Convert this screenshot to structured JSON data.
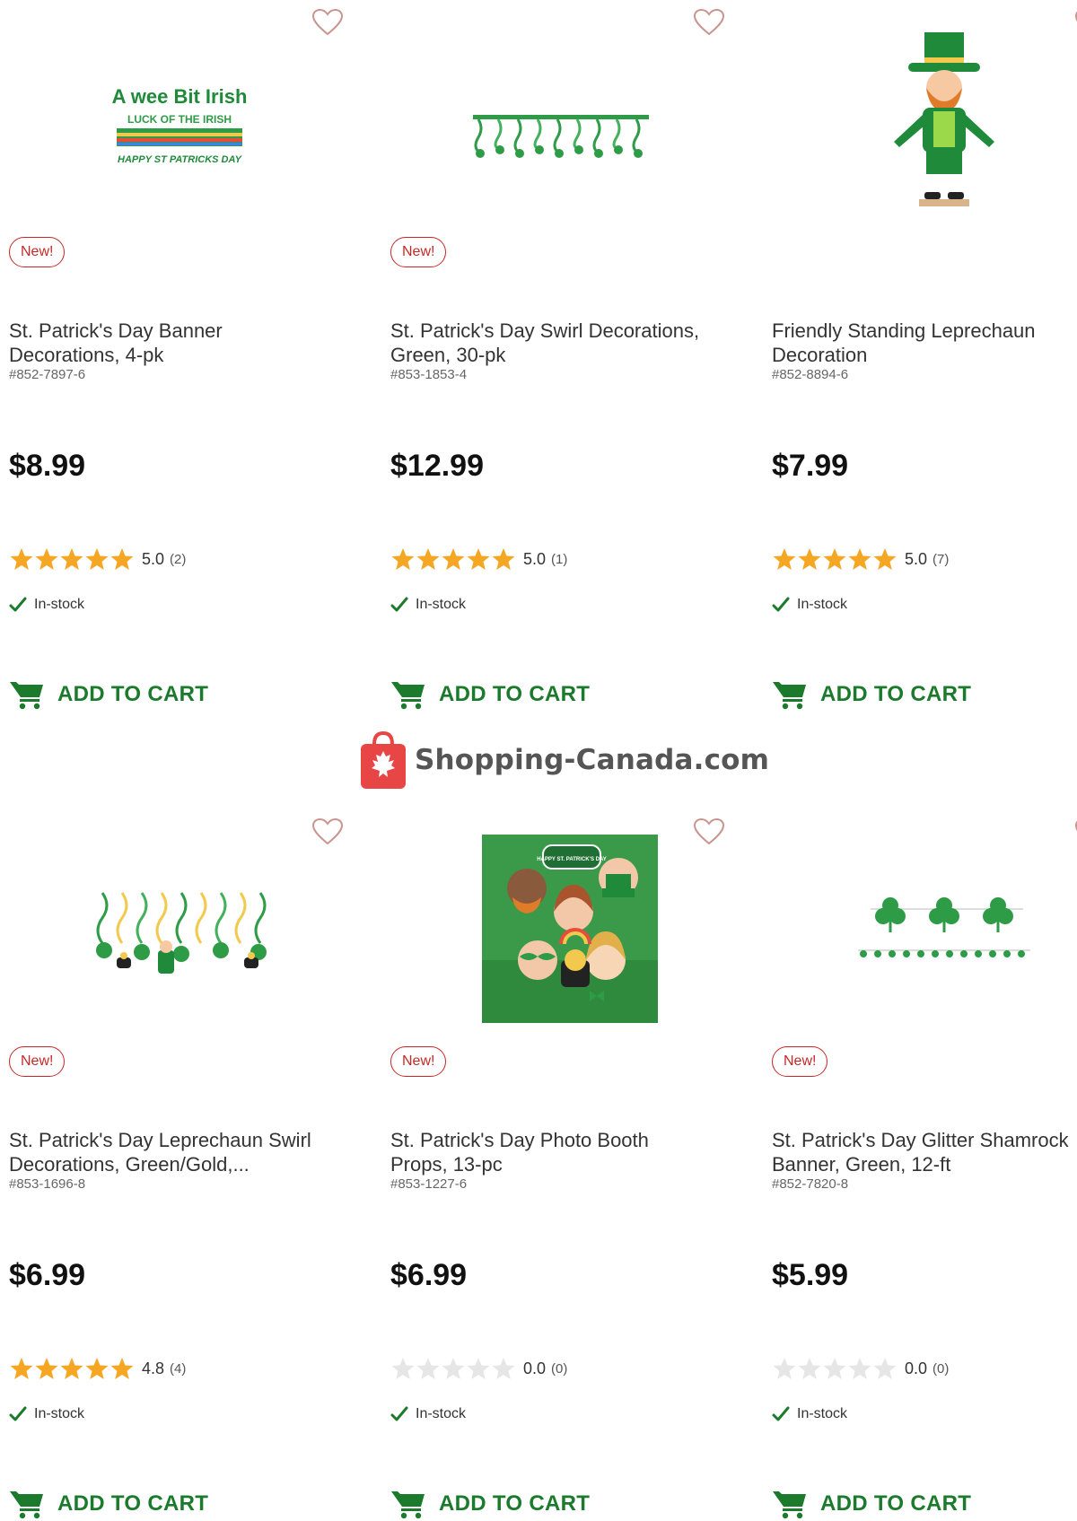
{
  "colors": {
    "accent_green": "#1b7a2c",
    "badge_red": "#c62828",
    "star_gold": "#f5a623",
    "star_empty": "#e6e6e6"
  },
  "watermark": {
    "text": "Shopping-Canada.com",
    "icon": "maple-leaf-bag-icon"
  },
  "products": [
    {
      "badge": "New!",
      "title": "St. Patrick's Day Banner Decorations, 4-pk",
      "sku": "#852-7897-6",
      "price": "$8.99",
      "rating": 5.0,
      "rating_text": "5.0",
      "review_count": "(2)",
      "stock": "In-stock",
      "cart_label": "ADD TO CART",
      "image": "banner-decorations-image",
      "banner_text": [
        "A wee Bit Irish",
        "LUCK OF THE IRISH",
        "HAPPY ST PATRICKS DAY"
      ]
    },
    {
      "badge": "New!",
      "title": "St. Patrick's Day Swirl Decorations, Green, 30-pk",
      "sku": "#853-1853-4",
      "price": "$12.99",
      "rating": 5.0,
      "rating_text": "5.0",
      "review_count": "(1)",
      "stock": "In-stock",
      "cart_label": "ADD TO CART",
      "image": "swirl-decorations-image"
    },
    {
      "badge": "",
      "title": "Friendly Standing Leprechaun Decoration",
      "sku": "#852-8894-6",
      "price": "$7.99",
      "rating": 5.0,
      "rating_text": "5.0",
      "review_count": "(7)",
      "stock": "In-stock",
      "cart_label": "ADD TO CART",
      "image": "leprechaun-figure-image"
    },
    {
      "badge": "New!",
      "title": "St. Patrick's Day Leprechaun Swirl Decorations, Green/Gold,...",
      "sku": "#853-1696-8",
      "price": "$6.99",
      "rating": 4.8,
      "rating_text": "4.8",
      "review_count": "(4)",
      "stock": "In-stock",
      "cart_label": "ADD TO CART",
      "image": "leprechaun-swirl-image"
    },
    {
      "badge": "New!",
      "title": "St. Patrick's Day Photo Booth Props, 13-pc",
      "sku": "#853-1227-6",
      "price": "$6.99",
      "rating": 0.0,
      "rating_text": "0.0",
      "review_count": "(0)",
      "stock": "In-stock",
      "cart_label": "ADD TO CART",
      "image": "photo-booth-props-image",
      "sign_text": "HAPPY ST. PATRICK'S DAY"
    },
    {
      "badge": "New!",
      "title": "St. Patrick's Day Glitter Shamrock Banner, Green, 12-ft",
      "sku": "#852-7820-8",
      "price": "$5.99",
      "rating": 0.0,
      "rating_text": "0.0",
      "review_count": "(0)",
      "stock": "In-stock",
      "cart_label": "ADD TO CART",
      "image": "shamrock-banner-image"
    }
  ]
}
